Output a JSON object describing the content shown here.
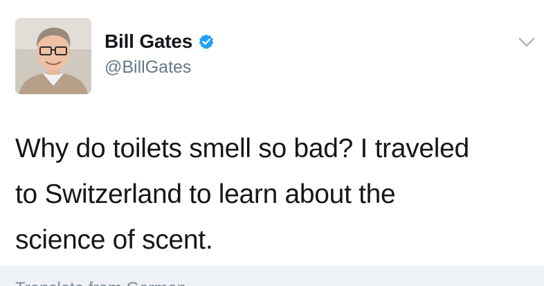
{
  "author": {
    "display_name": "Bill Gates",
    "handle": "@BillGates",
    "verified": true,
    "avatar_icon": "profile-photo"
  },
  "tweet": {
    "text": "Why do toilets smell so bad? I traveled\nto Switzerland to learn about the\nscience of scent."
  },
  "footer": {
    "translate_label": "Translate from German"
  },
  "colors": {
    "name": "#14171a",
    "handle": "#657786",
    "verified_badge": "#1da1f2",
    "chevron": "#aab8c2",
    "footer_background": "#eef2f6"
  },
  "icons": {
    "verified": "verified-badge-icon",
    "menu": "chevron-down-icon"
  }
}
